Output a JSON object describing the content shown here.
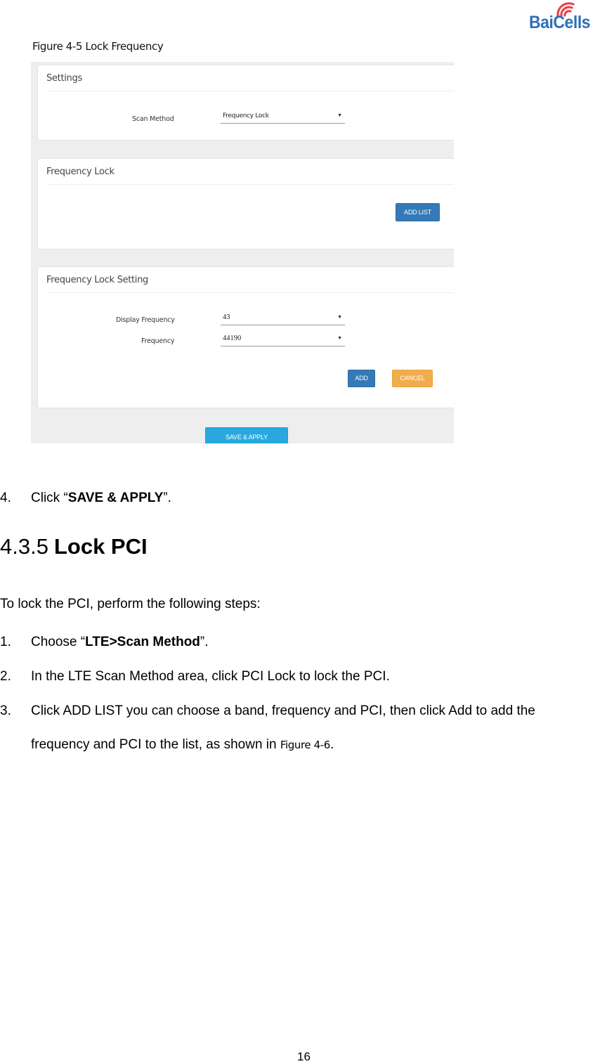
{
  "header": {
    "logo_text": "BaiCells",
    "logo_icon": "wifi-signal-icon",
    "logo_color": "#2d6fb8",
    "logo_icon_color": "#e8454a"
  },
  "figure": {
    "caption": "Figure 4-5 Lock Frequency",
    "settings_card": {
      "title": "Settings",
      "scan_method_label": "Scan Method",
      "scan_method_value": "Frequency Lock"
    },
    "frequency_lock_card": {
      "title": "Frequency Lock",
      "add_list_button": "ADD LIST"
    },
    "frequency_lock_setting_card": {
      "title": "Frequency Lock Setting",
      "display_frequency_label": "Display Frequency",
      "display_frequency_value": "43",
      "frequency_label": "Frequency",
      "frequency_value": "44190",
      "add_button": "ADD",
      "cancel_button": "CANCEL"
    },
    "save_apply_button": "SAVE & APPLY",
    "colors": {
      "primary_blue": "#337ab7",
      "cancel_orange": "#f0ad4e",
      "save_cyan": "#29a8e0",
      "panel_bg": "#eeeeee"
    }
  },
  "body": {
    "step4": {
      "number": "4.",
      "prefix": "Click “",
      "bold": "SAVE & APPLY",
      "suffix": "”."
    },
    "section": {
      "number": "4.3.5",
      "title": "Lock PCI"
    },
    "intro": "To lock the PCI, perform the following steps:",
    "steps": [
      {
        "number": "1.",
        "prefix": "Choose “",
        "bold": "LTE>Scan Method",
        "suffix": "”."
      },
      {
        "number": "2.",
        "text": "In the LTE Scan Method area, click PCI Lock to lock the PCI."
      },
      {
        "number": "3.",
        "line1": "Click ADD LIST you can choose a band, frequency and PCI, then click Add to add the",
        "line2": "frequency and PCI to the list, as shown in ",
        "figure_ref": "Figure 4-6",
        "end": "."
      }
    ]
  },
  "footer": {
    "page_number": "16"
  }
}
